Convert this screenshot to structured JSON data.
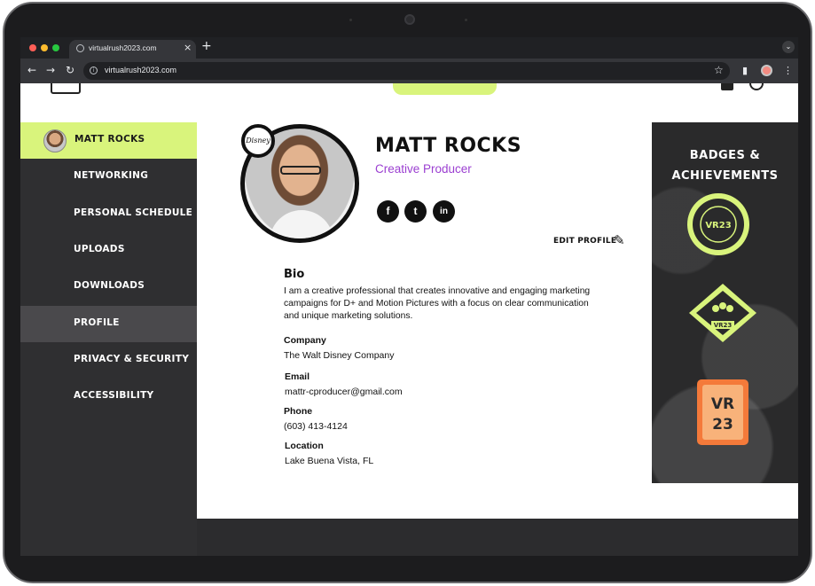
{
  "browser": {
    "tab_title": "virtualrush2023.com",
    "tab_close": "×",
    "new_tab": "+",
    "url": "virtualrush2023.com",
    "back": "←",
    "forward": "→",
    "reload": "↻",
    "menu": "⋮",
    "tab_menu": "⌄",
    "bookmark_star": "☆"
  },
  "sidebar": {
    "user_name": "MATT ROCKS",
    "items": [
      {
        "label": "NETWORKING"
      },
      {
        "label": "PERSONAL SCHEDULE"
      },
      {
        "label": "UPLOADS"
      },
      {
        "label": "DOWNLOADS"
      },
      {
        "label": "PROFILE"
      },
      {
        "label": "PRIVACY & SECURITY"
      },
      {
        "label": "ACCESSIBILITY"
      }
    ],
    "active": "PROFILE"
  },
  "profile": {
    "name": "MATT ROCKS",
    "role": "Creative Producer",
    "company_logo_text": "Disney",
    "edit_label": "EDIT PROFILE",
    "social": {
      "facebook": "f",
      "twitter": "t",
      "linkedin": "in"
    },
    "bio_heading": "Bio",
    "bio_text": "I am a creative professional that creates innovative and engaging marketing campaigns for D+ and Motion Pictures with a focus on clear communication and unique marketing solutions.",
    "fields": {
      "company_label": "Company",
      "company_value": "The Walt Disney Company",
      "email_label": "Email",
      "email_value": "mattr-cproducer@gmail.com",
      "phone_label": "Phone",
      "phone_value": "(603) 413-4124",
      "location_label": "Location",
      "location_value": "Lake Buena Vista, FL"
    }
  },
  "badges": {
    "title_line1": "BADGES &",
    "title_line2": "ACHIEVEMENTS",
    "items": [
      {
        "name": "vr23-circle-badge",
        "text": "VR23"
      },
      {
        "name": "vr23-diamond-badge",
        "text": "VR23"
      },
      {
        "name": "vr23-ticket-badge",
        "text1": "VR",
        "text2": "23"
      }
    ],
    "colors": {
      "lime": "#d9f47c",
      "orange": "#f47a3a"
    }
  },
  "colors": {
    "accent_lime": "#d9f47c",
    "role_purple": "#9b3fd1",
    "sidebar_bg": "#2f2f31",
    "active_bg": "#4a494c"
  }
}
